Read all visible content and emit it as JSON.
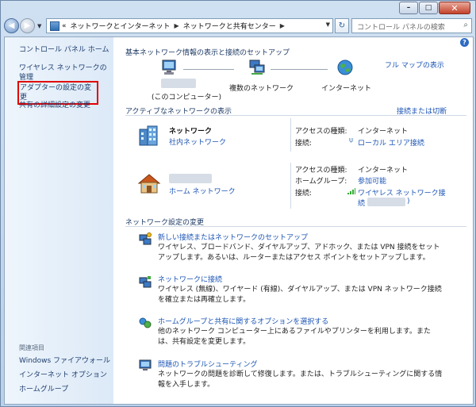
{
  "titlebar": {
    "min": "–",
    "max": "□",
    "close": "✕"
  },
  "address": {
    "overflow": "«",
    "crumbs": [
      "ネットワークとインターネット",
      "ネットワークと共有センター"
    ],
    "search_placeholder": "コントロール パネルの検索"
  },
  "sidebar": {
    "home": "コントロール パネル ホーム",
    "wireless": "ワイヤレス ネットワークの管理",
    "adapter": "アダプターの設定の変更",
    "sharing": "共有の詳細設定の変更",
    "related_head": "関連項目",
    "related": [
      "Windows ファイアウォール",
      "インターネット オプション",
      "ホームグループ"
    ]
  },
  "map": {
    "heading": "基本ネットワーク情報の表示と接続のセットアップ",
    "full_map": "フル マップの表示",
    "computer_label": "(このコンピューター)",
    "multi_label": "複数のネットワーク",
    "internet_label": "インターネット"
  },
  "active": {
    "heading": "アクティブなネットワークの表示",
    "connect_link": "接続または切断",
    "net1": {
      "name": "ネットワーク",
      "type": "社内ネットワーク",
      "access_k": "アクセスの種類:",
      "access_v": "インターネット",
      "conn_k": "接続:",
      "conn_v": "ローカル エリア接続"
    },
    "net2": {
      "type": "ホーム ネットワーク",
      "access_k": "アクセスの種類:",
      "access_v": "インターネット",
      "hg_k": "ホームグループ:",
      "hg_v": "参加可能",
      "conn_k": "接続:",
      "conn_v1": "ワイヤレス ネットワーク接",
      "conn_v2": "続 (",
      "conn_v3": ")"
    }
  },
  "change": {
    "heading": "ネットワーク設定の変更",
    "tasks": [
      {
        "title": "新しい接続またはネットワークのセットアップ",
        "desc": "ワイヤレス、ブロードバンド、ダイヤルアップ、アドホック、または VPN 接続をセットアップします。あるいは、ルーターまたはアクセス ポイントをセットアップします。"
      },
      {
        "title": "ネットワークに接続",
        "desc": "ワイヤレス (無線)、ワイヤード (有線)、ダイヤルアップ、または VPN ネットワーク接続を確立または再確立します。"
      },
      {
        "title": "ホームグループと共有に関するオプションを選択する",
        "desc": "他のネットワーク コンピューター上にあるファイルやプリンターを利用します。または、共有設定を変更します。"
      },
      {
        "title": "問題のトラブルシューティング",
        "desc": "ネットワークの問題を診断して修復します。または、トラブルシューティングに関する情報を入手します。"
      }
    ]
  },
  "colors": {
    "link": "#1c55b5",
    "highlight": "#e00000",
    "sidebar_bg": "#dce9f7"
  }
}
